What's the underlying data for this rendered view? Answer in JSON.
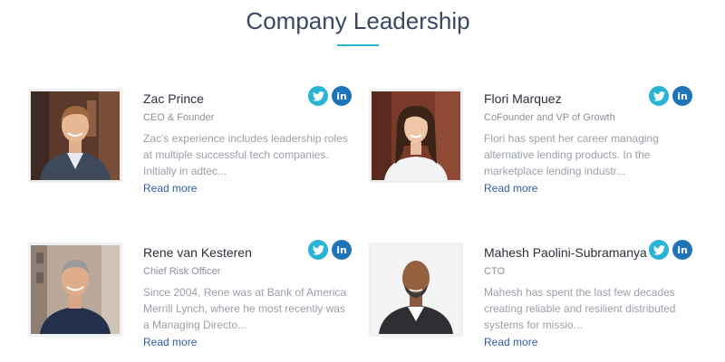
{
  "section": {
    "title": "Company Leadership"
  },
  "colors": {
    "title": "#3a4760",
    "accent": "#29b3d6",
    "twitter": "#29b3d6",
    "linkedin": "#1f73b7",
    "link": "#2c5ea8",
    "bio_text": "#9aa0a8"
  },
  "social": {
    "twitter_icon": "twitter-icon",
    "linkedin_icon": "linkedin-icon",
    "linkedin_glyph": "in"
  },
  "people": [
    {
      "name": "Zac Prince",
      "role": "CEO & Founder",
      "bio": "Zac's experience includes leadership roles at multiple successful tech companies. Initially in adtec...",
      "link": "Read more"
    },
    {
      "name": "Flori Marquez",
      "role": "CoFounder and VP of Growth",
      "bio": "Flori has spent her career managing alternative lending products. In the marketplace lending industr...",
      "link": "Read more"
    },
    {
      "name": "Rene van Kesteren",
      "role": "Chief Risk Officer",
      "bio": "Since 2004, Rene was at Bank of America Merrill Lynch, where he most recently was a Managing Directo...",
      "link": "Read more"
    },
    {
      "name": "Mahesh Paolini-Subramanya",
      "role": "CTO",
      "bio": "Mahesh has spent the last few decades creating reliable and resilient distributed systems for missio...",
      "link": "Read more"
    }
  ]
}
